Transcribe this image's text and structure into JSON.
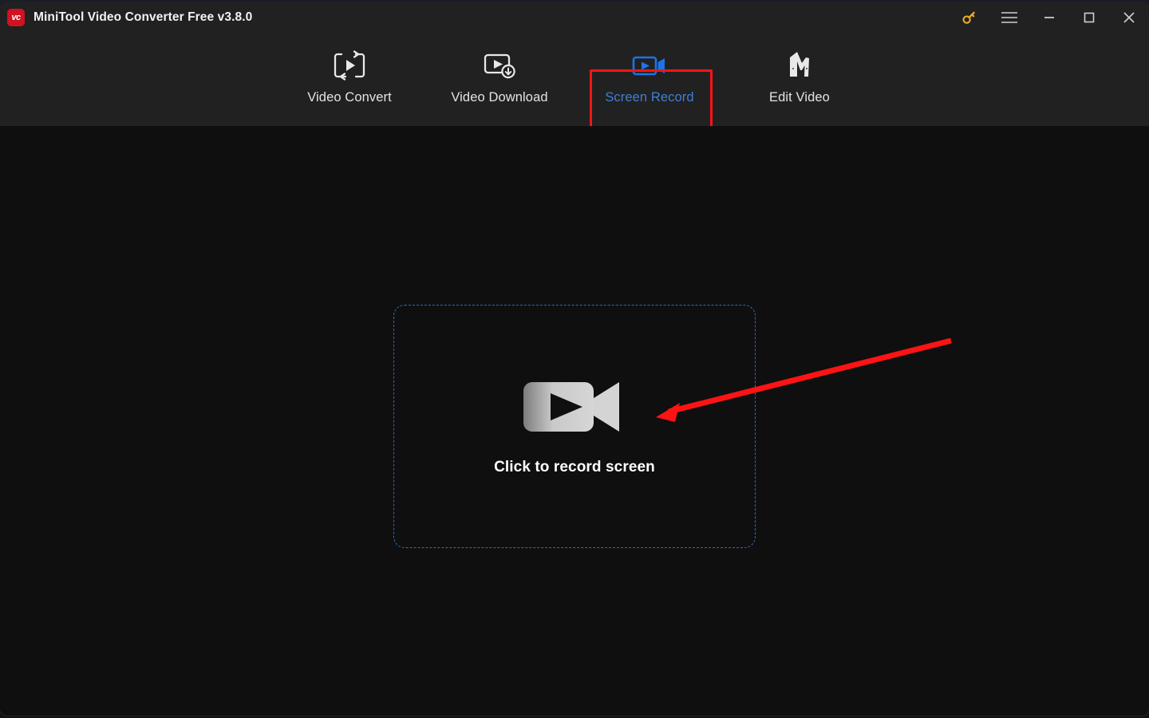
{
  "window": {
    "title": "MiniTool Video Converter Free v3.8.0",
    "logo_text": "vc",
    "logo_color": "#cf1320"
  },
  "titlebar": {
    "controls": [
      {
        "name": "key-icon",
        "label": "Register / Key",
        "color": "#f0ab25"
      },
      {
        "name": "hamburger-menu-icon",
        "label": "Menu",
        "color": "#cfcfcf"
      },
      {
        "name": "minimize-icon",
        "label": "Minimize",
        "color": "#cfcfcf"
      },
      {
        "name": "maximize-icon",
        "label": "Maximize",
        "color": "#cfcfcf"
      },
      {
        "name": "close-icon",
        "label": "Close",
        "color": "#cfcfcf"
      }
    ]
  },
  "tabs": [
    {
      "label": "Video Convert",
      "icon": "video-convert-icon",
      "active": false
    },
    {
      "label": "Video Download",
      "icon": "video-download-icon",
      "active": false
    },
    {
      "label": "Screen Record",
      "icon": "screen-record-icon",
      "active": true
    },
    {
      "label": "Edit Video",
      "icon": "edit-video-icon",
      "active": false
    }
  ],
  "main": {
    "dropzone_label": "Click to record screen",
    "dropzone_icon": "video-camera-icon"
  },
  "annotations": {
    "highlight_target": "Screen Record",
    "highlight_color": "#fc1414",
    "arrow_color": "#fc1414",
    "arrow_from": "1192,423",
    "arrow_to": "823,518"
  },
  "colors": {
    "titlebar_bg": "#212121",
    "tabbar_bg": "#212121",
    "content_bg": "#0f0f0f",
    "active_tab_text": "#3f7fd6",
    "inactive_tab_text": "#e3e3e3",
    "dropzone_border": "#2f6fc2"
  }
}
